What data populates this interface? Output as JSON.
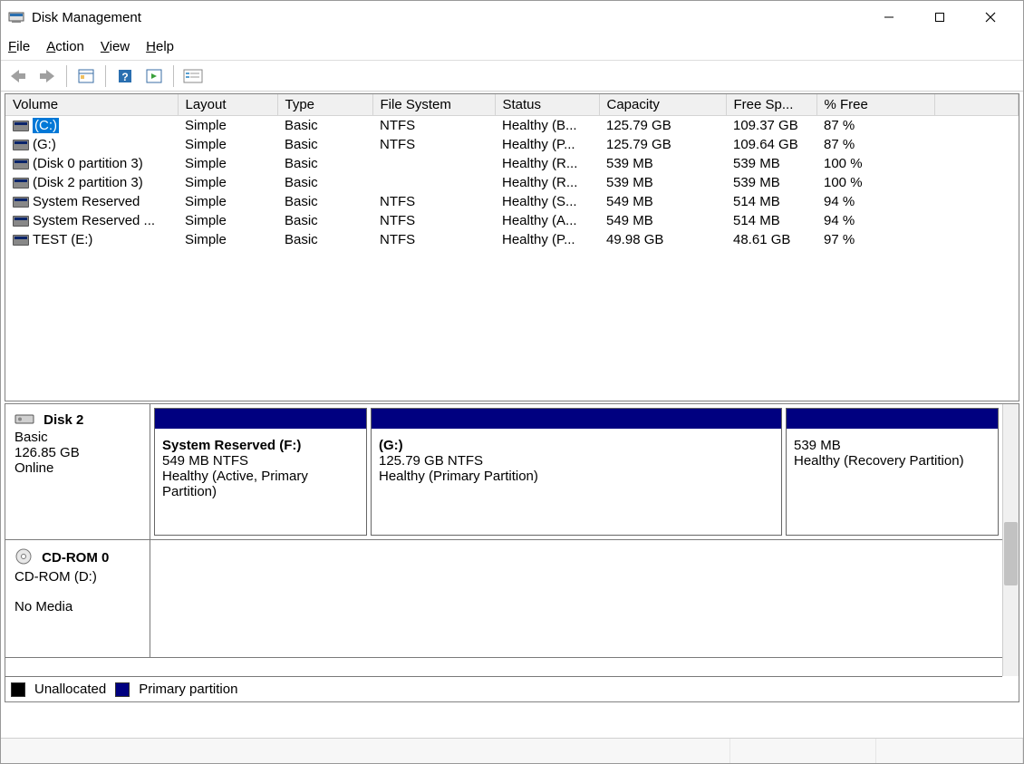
{
  "window": {
    "title": "Disk Management"
  },
  "menubar": {
    "file": "File",
    "action": "Action",
    "view": "View",
    "help": "Help"
  },
  "columns": {
    "volume": "Volume",
    "layout": "Layout",
    "type": "Type",
    "filesystem": "File System",
    "status": "Status",
    "capacity": "Capacity",
    "freespace": "Free Sp...",
    "pctfree": "% Free"
  },
  "volumes": [
    {
      "name": "(C:)",
      "layout": "Simple",
      "type": "Basic",
      "fs": "NTFS",
      "status": "Healthy (B...",
      "capacity": "125.79 GB",
      "free": "109.37 GB",
      "pct": "87 %",
      "selected": true
    },
    {
      "name": " (G:)",
      "layout": "Simple",
      "type": "Basic",
      "fs": "NTFS",
      "status": "Healthy (P...",
      "capacity": "125.79 GB",
      "free": "109.64 GB",
      "pct": "87 %"
    },
    {
      "name": "(Disk 0 partition 3)",
      "layout": "Simple",
      "type": "Basic",
      "fs": "",
      "status": "Healthy (R...",
      "capacity": "539 MB",
      "free": "539 MB",
      "pct": "100 %"
    },
    {
      "name": "(Disk 2 partition 3)",
      "layout": "Simple",
      "type": "Basic",
      "fs": "",
      "status": "Healthy (R...",
      "capacity": "539 MB",
      "free": "539 MB",
      "pct": "100 %"
    },
    {
      "name": "System Reserved",
      "layout": "Simple",
      "type": "Basic",
      "fs": "NTFS",
      "status": "Healthy (S...",
      "capacity": "549 MB",
      "free": "514 MB",
      "pct": "94 %"
    },
    {
      "name": "System Reserved ...",
      "layout": "Simple",
      "type": "Basic",
      "fs": "NTFS",
      "status": "Healthy (A...",
      "capacity": "549 MB",
      "free": "514 MB",
      "pct": "94 %"
    },
    {
      "name": "TEST (E:)",
      "layout": "Simple",
      "type": "Basic",
      "fs": "NTFS",
      "status": "Healthy (P...",
      "capacity": "49.98 GB",
      "free": "48.61 GB",
      "pct": "97 %"
    }
  ],
  "disks": {
    "disk2": {
      "name": "Disk 2",
      "type": "Basic",
      "size": "126.85 GB",
      "status": "Online",
      "parts": [
        {
          "title": "System Reserved  (F:)",
          "line2": "549 MB NTFS",
          "line3": "Healthy (Active, Primary Partition)",
          "flex": "0 0 235px"
        },
        {
          "title": "(G:)",
          "line2": "125.79 GB NTFS",
          "line3": "Healthy (Primary Partition)",
          "flex": "1 1 auto"
        },
        {
          "title": "",
          "line2": "539 MB",
          "line3": "Healthy (Recovery Partition)",
          "flex": "0 0 235px"
        }
      ]
    },
    "cdrom": {
      "name": "CD-ROM 0",
      "type": "CD-ROM (D:)",
      "status": "No Media"
    }
  },
  "legend": {
    "unallocated": "Unallocated",
    "primary": "Primary partition"
  }
}
